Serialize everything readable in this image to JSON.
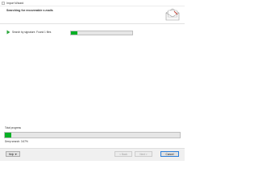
{
  "window": {
    "title": "Import Wizard"
  },
  "header": {
    "title": "Searching for recoverable e-mails"
  },
  "task": {
    "label": "Search by signature. Found 1 files",
    "progress": 0.1
  },
  "total": {
    "label": "Total progress",
    "progress": 0.0367,
    "status": "Deep search: 3.67%"
  },
  "buttons": {
    "help": "Help ▼",
    "back": "< Back",
    "next": "Next >",
    "cancel": "Cancel"
  },
  "colors": {
    "progress_fill": "#06b025",
    "play_icon": "#2aa63a"
  }
}
